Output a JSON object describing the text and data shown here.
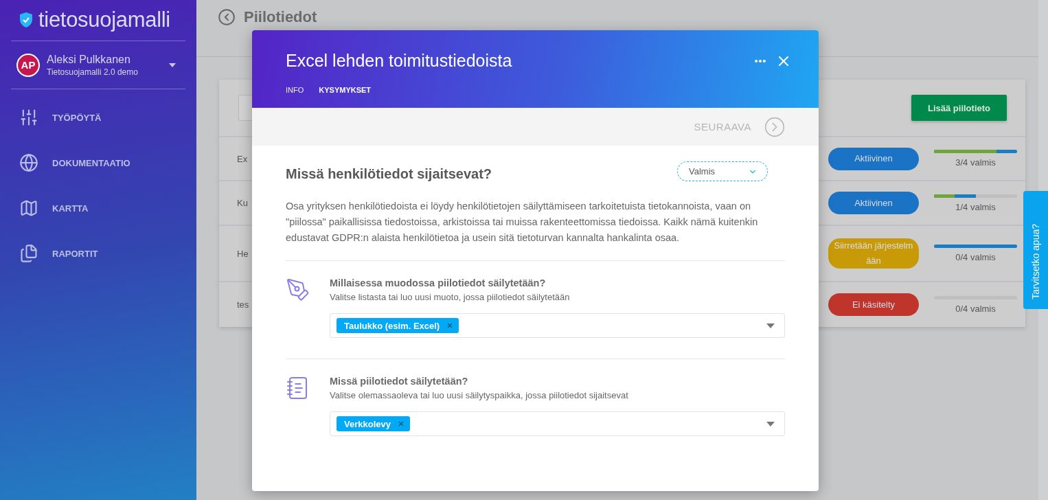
{
  "sidebar": {
    "logo": "tietosuojamalli",
    "user": {
      "initials": "AP",
      "name": "Aleksi Pulkkanen",
      "organization": "Tietosuojamalli 2.0 demo"
    },
    "nav": [
      {
        "label": "TYÖPÖYTÄ",
        "kind": "sliders"
      },
      {
        "label": "DOKUMENTAATIO",
        "kind": "globe"
      },
      {
        "label": "KARTTA",
        "kind": "map"
      },
      {
        "label": "RAPORTIT",
        "kind": "files"
      }
    ]
  },
  "page": {
    "title": "Piilotiedot",
    "add_button": "Lisää piilotieto",
    "rows": [
      {
        "name": "Ex",
        "status": {
          "label": "Aktiivinen",
          "color": "#1a73c4"
        },
        "progress": [
          {
            "color": "#1a7cc4",
            "level": 1
          },
          {
            "color": "#6fa53a",
            "level": 0.75
          }
        ],
        "progress_label": "3/4 valmis"
      },
      {
        "name": "Ku",
        "status": {
          "label": "Aktiivinen",
          "color": "#1a73c4"
        },
        "progress": [
          {
            "color": "#1a7cc4",
            "level": 0.5
          },
          {
            "color": "#6fa53a",
            "level": 0.25
          }
        ],
        "progress_label": "1/4 valmis"
      },
      {
        "name": "He",
        "status": {
          "label": "Siirretään järjestelmään",
          "color": "#c99a07"
        },
        "progress": [
          {
            "color": "#1a7cc4",
            "level": 1
          }
        ],
        "progress_label": "0/4 valmis"
      },
      {
        "name": "tes",
        "status": {
          "label": "Ei käsitelty",
          "color": "#c0352b"
        },
        "progress": [
          {
            "level": 0
          }
        ],
        "progress_label": "0/4 valmis"
      }
    ]
  },
  "help": {
    "label": "Tarvitsetko apua?"
  },
  "modal": {
    "title": "Excel lehden toimitustiedoista",
    "tabs": [
      {
        "label": "INFO",
        "selected": false
      },
      {
        "label": "KYSYMYKSET",
        "selected": true
      }
    ],
    "next": "SEURAAVA",
    "question": "Missä henkilötiedot sijaitsevat?",
    "status": "Valmis",
    "description": "Osa yrityksen henkilötiedoista ei löydy henkilötietojen säilyttämiseen tarkoitetuista tietokannoista, vaan on \"piilossa\" paikallisissa tiedostoissa, arkistoissa tai muissa rakenteettomissa tiedoissa. Kaikk nämä kuitenkin edustavat GDPR:n alaista henkilötietoa ja usein sitä tietoturvan kannalta hankalinta osaa.",
    "fields": [
      {
        "kind": "pen",
        "label": "Millaisessa muodossa piilotiedot säilytetään?",
        "hint": "Valitse listasta tai luo uusi muoto, jossa piilotiedot säilytetään",
        "tags": [
          "Taulukko (esim. Excel)"
        ]
      },
      {
        "kind": "notebook",
        "label": "Missä piilotiedot säilytetään?",
        "hint": "Valitse olemassaoleva tai luo uusi säilytyspaikka, jossa piilotiedot sijaitsevat",
        "tags": [
          "Verkkolevy"
        ]
      }
    ]
  }
}
